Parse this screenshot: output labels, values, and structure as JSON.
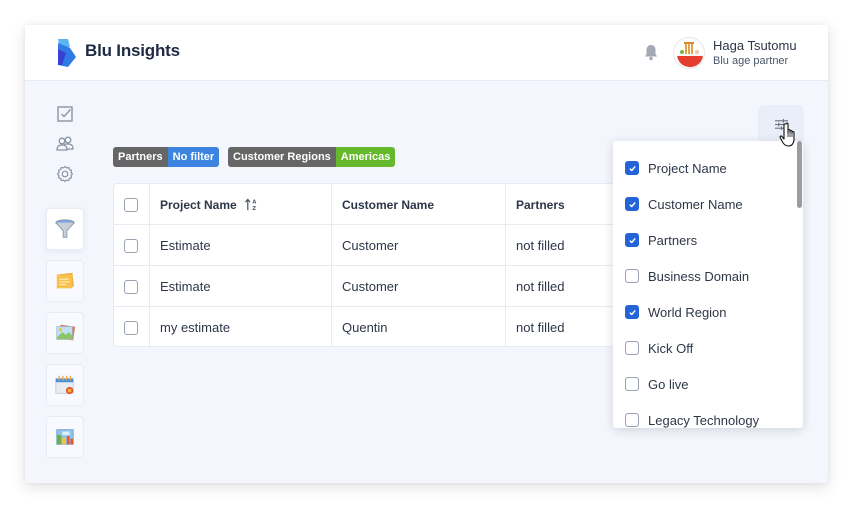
{
  "app": {
    "brand": "Blu Insights",
    "logo_icon": "blu-insights-logo"
  },
  "header": {
    "notification_icon": "bell-icon",
    "user": {
      "name": "Haga Tsutomu",
      "role": "Blu age partner",
      "avatar_icon": "ramen-bowl-avatar"
    }
  },
  "sidebar": {
    "top_icons": [
      {
        "name": "checkbox-icon"
      },
      {
        "name": "users-icon"
      },
      {
        "name": "gear-icon"
      }
    ],
    "cards": [
      {
        "name": "funnel-icon",
        "active": true
      },
      {
        "name": "sticky-note-icon",
        "active": false
      },
      {
        "name": "picture-icon",
        "active": false
      },
      {
        "name": "calendar-icon",
        "active": false
      },
      {
        "name": "dashboard-icon",
        "active": false
      }
    ]
  },
  "filters": [
    {
      "key": "Partners",
      "value": "No filter",
      "color": "#3c84e0"
    },
    {
      "key": "Customer Regions",
      "value": "Americas",
      "color": "#66b92c"
    }
  ],
  "table": {
    "columns": [
      "Project Name",
      "Customer Name",
      "Partners"
    ],
    "sort_icon": "sort-alpha-asc-icon",
    "rows": [
      {
        "project": "Estimate",
        "customer": "Customer",
        "partners": "not filled"
      },
      {
        "project": "Estimate",
        "customer": "Customer",
        "partners": "not filled"
      },
      {
        "project": "my estimate",
        "customer": "Quentin",
        "partners": "not filled"
      }
    ]
  },
  "column_menu": {
    "button_icon": "sliders-icon",
    "items": [
      {
        "label": "Project Name",
        "checked": true
      },
      {
        "label": "Customer Name",
        "checked": true
      },
      {
        "label": "Partners",
        "checked": true
      },
      {
        "label": "Business Domain",
        "checked": false
      },
      {
        "label": "World Region",
        "checked": true
      },
      {
        "label": "Kick Off",
        "checked": false
      },
      {
        "label": "Go live",
        "checked": false
      },
      {
        "label": "Legacy Technology",
        "checked": false
      }
    ]
  },
  "colors": {
    "accent": "#2563d8",
    "background": "#f3f6fd",
    "chip_key": "#666666"
  }
}
